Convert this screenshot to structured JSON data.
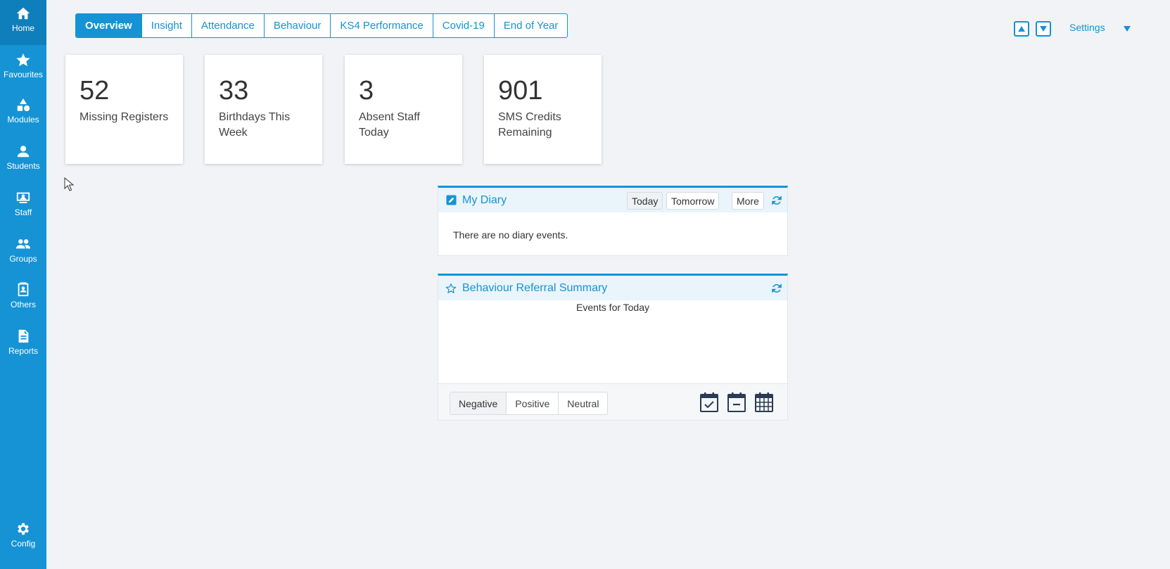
{
  "sidebar": {
    "items": [
      {
        "label": "Home",
        "icon": "home-icon"
      },
      {
        "label": "Favourites",
        "icon": "star-icon"
      },
      {
        "label": "Modules",
        "icon": "shapes-icon"
      },
      {
        "label": "Students",
        "icon": "person-icon"
      },
      {
        "label": "Staff",
        "icon": "staff-icon"
      },
      {
        "label": "Groups",
        "icon": "group-icon"
      },
      {
        "label": "Others",
        "icon": "contact-book-icon"
      },
      {
        "label": "Reports",
        "icon": "document-icon"
      }
    ],
    "config": {
      "label": "Config",
      "icon": "gear-icon"
    }
  },
  "tabs": [
    "Overview",
    "Insight",
    "Attendance",
    "Behaviour",
    "KS4 Performance",
    "Covid-19",
    "End of Year"
  ],
  "topbar": {
    "settings_label": "Settings"
  },
  "cards": [
    {
      "value": "52",
      "label": "Missing Registers"
    },
    {
      "value": "33",
      "label": "Birthdays This Week"
    },
    {
      "value": "3",
      "label": "Absent Staff Today"
    },
    {
      "value": "901",
      "label": "SMS Credits Remaining"
    }
  ],
  "diary": {
    "title": "My Diary",
    "today_label": "Today",
    "tomorrow_label": "Tomorrow",
    "more_label": "More",
    "empty_text": "There are no diary events."
  },
  "behaviour": {
    "title": "Behaviour Referral Summary",
    "events_label": "Events for Today",
    "filters": [
      "Negative",
      "Positive",
      "Neutral"
    ]
  },
  "colors": {
    "accent": "#1593d4",
    "background": "#f1f3f6"
  }
}
